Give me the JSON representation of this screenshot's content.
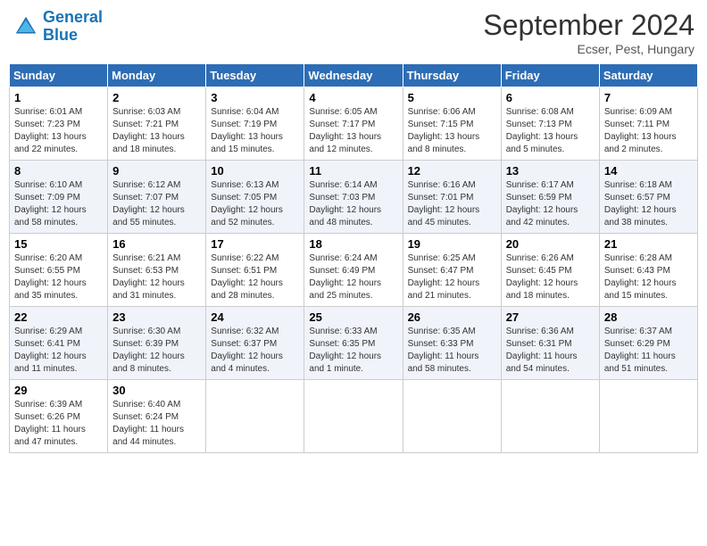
{
  "header": {
    "logo_line1": "General",
    "logo_line2": "Blue",
    "month": "September 2024",
    "location": "Ecser, Pest, Hungary"
  },
  "days_of_week": [
    "Sunday",
    "Monday",
    "Tuesday",
    "Wednesday",
    "Thursday",
    "Friday",
    "Saturday"
  ],
  "weeks": [
    [
      {
        "day": "1",
        "info": "Sunrise: 6:01 AM\nSunset: 7:23 PM\nDaylight: 13 hours\nand 22 minutes."
      },
      {
        "day": "2",
        "info": "Sunrise: 6:03 AM\nSunset: 7:21 PM\nDaylight: 13 hours\nand 18 minutes."
      },
      {
        "day": "3",
        "info": "Sunrise: 6:04 AM\nSunset: 7:19 PM\nDaylight: 13 hours\nand 15 minutes."
      },
      {
        "day": "4",
        "info": "Sunrise: 6:05 AM\nSunset: 7:17 PM\nDaylight: 13 hours\nand 12 minutes."
      },
      {
        "day": "5",
        "info": "Sunrise: 6:06 AM\nSunset: 7:15 PM\nDaylight: 13 hours\nand 8 minutes."
      },
      {
        "day": "6",
        "info": "Sunrise: 6:08 AM\nSunset: 7:13 PM\nDaylight: 13 hours\nand 5 minutes."
      },
      {
        "day": "7",
        "info": "Sunrise: 6:09 AM\nSunset: 7:11 PM\nDaylight: 13 hours\nand 2 minutes."
      }
    ],
    [
      {
        "day": "8",
        "info": "Sunrise: 6:10 AM\nSunset: 7:09 PM\nDaylight: 12 hours\nand 58 minutes."
      },
      {
        "day": "9",
        "info": "Sunrise: 6:12 AM\nSunset: 7:07 PM\nDaylight: 12 hours\nand 55 minutes."
      },
      {
        "day": "10",
        "info": "Sunrise: 6:13 AM\nSunset: 7:05 PM\nDaylight: 12 hours\nand 52 minutes."
      },
      {
        "day": "11",
        "info": "Sunrise: 6:14 AM\nSunset: 7:03 PM\nDaylight: 12 hours\nand 48 minutes."
      },
      {
        "day": "12",
        "info": "Sunrise: 6:16 AM\nSunset: 7:01 PM\nDaylight: 12 hours\nand 45 minutes."
      },
      {
        "day": "13",
        "info": "Sunrise: 6:17 AM\nSunset: 6:59 PM\nDaylight: 12 hours\nand 42 minutes."
      },
      {
        "day": "14",
        "info": "Sunrise: 6:18 AM\nSunset: 6:57 PM\nDaylight: 12 hours\nand 38 minutes."
      }
    ],
    [
      {
        "day": "15",
        "info": "Sunrise: 6:20 AM\nSunset: 6:55 PM\nDaylight: 12 hours\nand 35 minutes."
      },
      {
        "day": "16",
        "info": "Sunrise: 6:21 AM\nSunset: 6:53 PM\nDaylight: 12 hours\nand 31 minutes."
      },
      {
        "day": "17",
        "info": "Sunrise: 6:22 AM\nSunset: 6:51 PM\nDaylight: 12 hours\nand 28 minutes."
      },
      {
        "day": "18",
        "info": "Sunrise: 6:24 AM\nSunset: 6:49 PM\nDaylight: 12 hours\nand 25 minutes."
      },
      {
        "day": "19",
        "info": "Sunrise: 6:25 AM\nSunset: 6:47 PM\nDaylight: 12 hours\nand 21 minutes."
      },
      {
        "day": "20",
        "info": "Sunrise: 6:26 AM\nSunset: 6:45 PM\nDaylight: 12 hours\nand 18 minutes."
      },
      {
        "day": "21",
        "info": "Sunrise: 6:28 AM\nSunset: 6:43 PM\nDaylight: 12 hours\nand 15 minutes."
      }
    ],
    [
      {
        "day": "22",
        "info": "Sunrise: 6:29 AM\nSunset: 6:41 PM\nDaylight: 12 hours\nand 11 minutes."
      },
      {
        "day": "23",
        "info": "Sunrise: 6:30 AM\nSunset: 6:39 PM\nDaylight: 12 hours\nand 8 minutes."
      },
      {
        "day": "24",
        "info": "Sunrise: 6:32 AM\nSunset: 6:37 PM\nDaylight: 12 hours\nand 4 minutes."
      },
      {
        "day": "25",
        "info": "Sunrise: 6:33 AM\nSunset: 6:35 PM\nDaylight: 12 hours\nand 1 minute."
      },
      {
        "day": "26",
        "info": "Sunrise: 6:35 AM\nSunset: 6:33 PM\nDaylight: 11 hours\nand 58 minutes."
      },
      {
        "day": "27",
        "info": "Sunrise: 6:36 AM\nSunset: 6:31 PM\nDaylight: 11 hours\nand 54 minutes."
      },
      {
        "day": "28",
        "info": "Sunrise: 6:37 AM\nSunset: 6:29 PM\nDaylight: 11 hours\nand 51 minutes."
      }
    ],
    [
      {
        "day": "29",
        "info": "Sunrise: 6:39 AM\nSunset: 6:26 PM\nDaylight: 11 hours\nand 47 minutes."
      },
      {
        "day": "30",
        "info": "Sunrise: 6:40 AM\nSunset: 6:24 PM\nDaylight: 11 hours\nand 44 minutes."
      },
      {
        "day": "",
        "info": ""
      },
      {
        "day": "",
        "info": ""
      },
      {
        "day": "",
        "info": ""
      },
      {
        "day": "",
        "info": ""
      },
      {
        "day": "",
        "info": ""
      }
    ]
  ]
}
